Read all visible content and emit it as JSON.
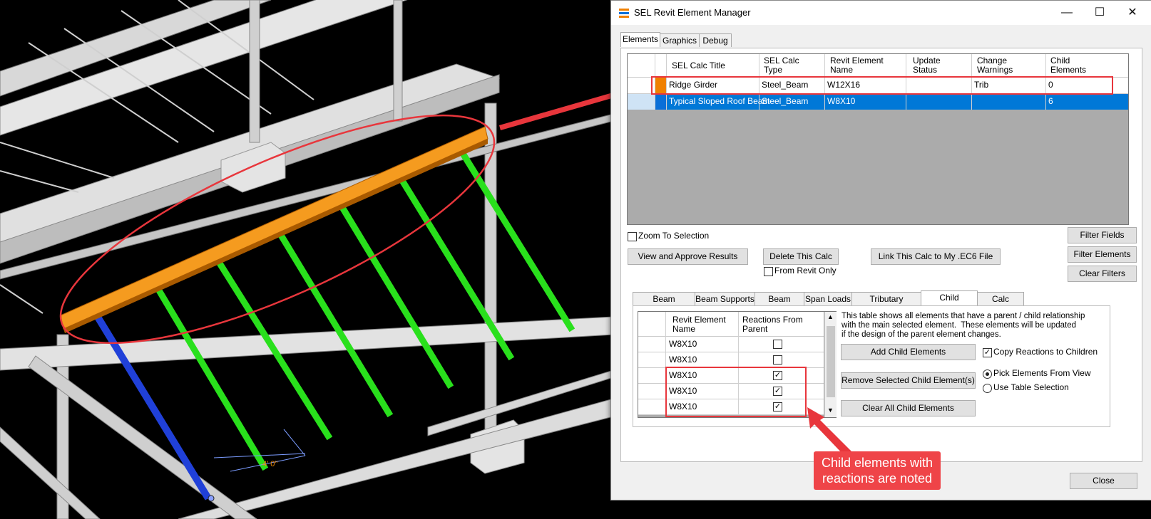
{
  "window": {
    "title": "SEL Revit Element Manager",
    "minimize": "—",
    "maximize": "☐",
    "close": "✕"
  },
  "top_tabs": [
    "Elements",
    "Graphics",
    "Debug"
  ],
  "elements_grid": {
    "headers": [
      "SEL Calc Title",
      "SEL Calc\nType",
      "Revit Element\nName",
      "Update\nStatus",
      "Change\nWarnings",
      "Child\nElements"
    ],
    "rows": [
      {
        "title": "Ridge Girder",
        "type": "Steel_Beam",
        "name": "W12X16",
        "status": "",
        "warnings": "Trib",
        "children": "0",
        "color": "#f08000"
      },
      {
        "title": "Typical Sloped Roof Beam",
        "type": "Steel_Beam",
        "name": "W8X10",
        "status": "",
        "warnings": "",
        "children": "6",
        "color": "#0a6fd8"
      }
    ]
  },
  "controls": {
    "zoom_to_selection": "Zoom To Selection",
    "view_approve": "View and Approve Results",
    "delete_calc": "Delete This Calc",
    "from_revit_only": "From Revit Only",
    "link_calc": "Link This Calc to My .EC6 File",
    "filter_fields": "Filter Fields",
    "filter_elements": "Filter Elements",
    "clear_filters": "Clear Filters",
    "close": "Close"
  },
  "sub_tabs": [
    "Beam Properties",
    "Beam Supports",
    "Beam Spans",
    "Span Loads",
    "Tributary Elements",
    "Child Elements",
    "Calc Results"
  ],
  "child_panel": {
    "headers": [
      "Revit Element\nName",
      "Reactions From\nParent"
    ],
    "rows": [
      {
        "name": "W8X10",
        "checked": false
      },
      {
        "name": "W8X10",
        "checked": false
      },
      {
        "name": "W8X10",
        "checked": true
      },
      {
        "name": "W8X10",
        "checked": true
      },
      {
        "name": "W8X10",
        "checked": true
      }
    ],
    "description": "This table shows all elements that have a parent / child relationship\nwith the main selected element.  These elements will be updated\nif the design of the parent element changes.",
    "add_child": "Add Child Elements",
    "remove_child": "Remove Selected Child Element(s)",
    "clear_child": "Clear All Child Elements",
    "copy_reactions": "Copy Reactions to Children",
    "pick_from_view": "Pick Elements From View",
    "use_table": "Use Table Selection"
  },
  "callout": {
    "text": "Child elements with\nreactions are noted"
  },
  "colors": {
    "highlight_red": "#e8363c",
    "girder_orange": "#f39a1e",
    "beam_green": "#2ee51f",
    "beam_blue": "#1f3fd0",
    "selection_blue": "#0078d7"
  }
}
